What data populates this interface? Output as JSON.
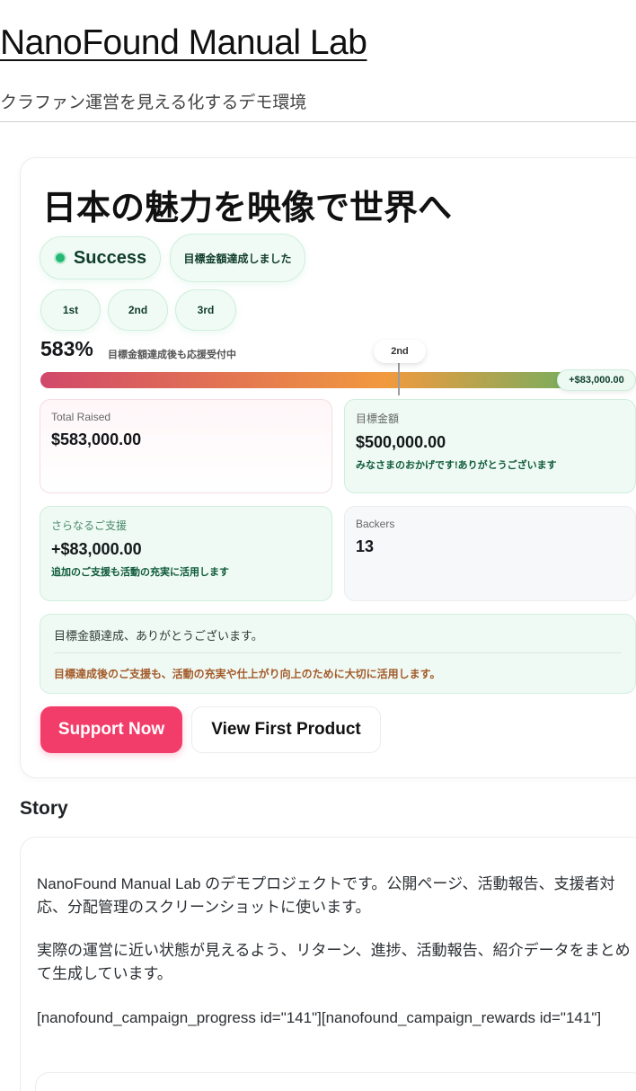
{
  "site": {
    "title": "NanoFound Manual Lab",
    "tagline": "クラファン運営を見える化するデモ環境"
  },
  "campaign": {
    "title": "日本の魅力を映像で世界へ",
    "status_label": "Success",
    "achieved_label": "目標金額達成しました",
    "ranks": [
      "1st",
      "2nd",
      "3rd"
    ],
    "percent_label": "583%",
    "percent_note": "目標金額達成後も応援受付中",
    "progress": {
      "percent": 583,
      "marker_label": "2nd",
      "extra_label": "+$83,000.00"
    },
    "stats": {
      "total_raised": {
        "label": "Total Raised",
        "value": "$583,000.00"
      },
      "goal": {
        "label": "目標金額",
        "value": "$500,000.00",
        "note": "みなさまのおかげです!ありがとうございます"
      },
      "extra": {
        "label": "さらなるご支援",
        "value": "+$83,000.00",
        "note": "追加のご支援も活動の充実に活用します"
      },
      "backers": {
        "label": "Backers",
        "value": "13"
      }
    },
    "thanks": {
      "line1": "目標金額達成、ありがとうございます。",
      "line2": "目標達成後のご支援も、活動の充実や仕上がり向上のために大切に活用します。"
    },
    "buttons": {
      "support": "Support Now",
      "view_first": "View First Product"
    }
  },
  "story": {
    "heading": "Story",
    "paragraphs": [
      "NanoFound Manual Lab のデモプロジェクトです。公開ページ、活動報告、支援者対応、分配管理のスクリーンショットに使います。",
      "実際の運営に近い状態が見えるよう、リターン、進捗、活動報告、紹介データをまとめて生成しています。",
      "[nanofound_campaign_progress id=\"141\"][nanofound_campaign_rewards id=\"141\"]"
    ]
  },
  "colors": {
    "accent": "#f23d6a",
    "success": "#23b873",
    "bar_start": "#d1486a",
    "bar_mid": "#f19a3e",
    "bar_end": "#4fb46a"
  }
}
